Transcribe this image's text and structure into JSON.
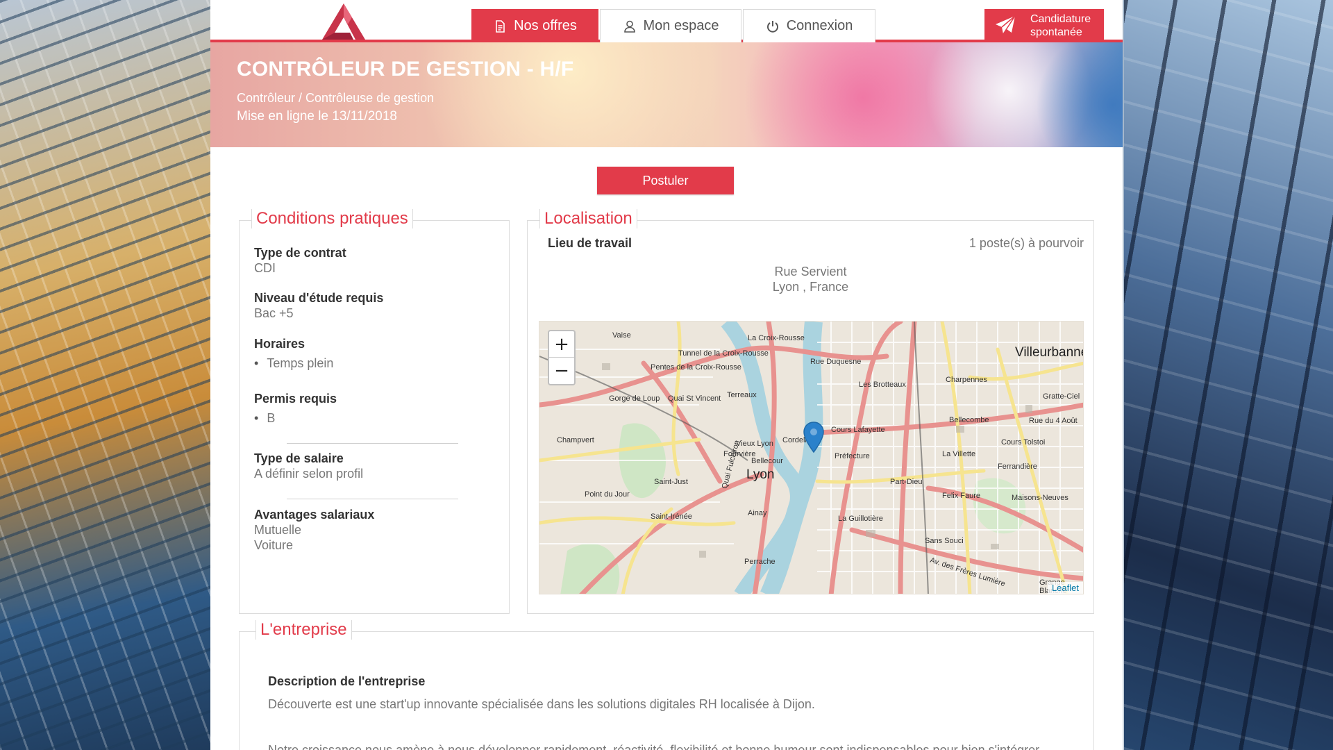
{
  "header": {
    "nav": [
      {
        "label": "Nos offres",
        "icon": "document-icon"
      },
      {
        "label": "Mon espace",
        "icon": "user-icon"
      },
      {
        "label": "Connexion",
        "icon": "power-icon"
      }
    ],
    "spontaneous_line1": "Candidature",
    "spontaneous_line2": "spontanée",
    "accent_color": "#e23b4a"
  },
  "hero": {
    "title": "CONTRÔLEUR DE GESTION - H/F",
    "subtitle": "Contrôleur / Contrôleuse de gestion",
    "posted": "Mise en ligne le 13/11/2018"
  },
  "apply_label": "Postuler",
  "conditions": {
    "legend": "Conditions pratiques",
    "contract_label": "Type de contrat",
    "contract_value": "CDI",
    "education_label": "Niveau d'étude requis",
    "education_value": "Bac +5",
    "hours_label": "Horaires",
    "hours_items": [
      "Temps plein"
    ],
    "license_label": "Permis requis",
    "license_items": [
      "B"
    ],
    "salary_label": "Type de salaire",
    "salary_value": "A définir selon profil",
    "benefits_label": "Avantages salariaux",
    "benefits_items": [
      "Mutuelle",
      "Voiture"
    ]
  },
  "location": {
    "legend": "Localisation",
    "workplace_label": "Lieu de travail",
    "positions": "1 poste(s) à pourvoir",
    "address_line1": "Rue Servient",
    "address_line2": "Lyon , France",
    "map": {
      "zoom_in": "+",
      "zoom_out": "−",
      "attribution": "Leaflet",
      "labels": [
        "Villeurbanne",
        "Lyon",
        "La Croix-Rousse",
        "Rue Duquesne",
        "Les Brotteaux",
        "Cours Lafayette",
        "Charpennes",
        "Gratte-Ciel",
        "Bellecombe",
        "Rue du 4 Août",
        "Cours Tolstoi",
        "La Villette",
        "Ferrandière",
        "Felix Faure",
        "Maisons-Neuves",
        "Part-Dieu",
        "Préfecture",
        "Vieux Lyon",
        "Fourvière",
        "Saint-Just",
        "Saint-Irénée",
        "Point du Jour",
        "Champvert",
        "Gorge de Loup",
        "Ainay",
        "Perrache",
        "La Guillotière",
        "Sans Souci",
        "Av. des Frères Lumière",
        "Grange Blanche",
        "Tunnel de la Croix-Rousse",
        "Pentes de la Croix-Rousse",
        "Quai St Vincent",
        "Terreaux",
        "Vaise",
        "Quai Fulchiron",
        "Cordeliers",
        "Bellecour"
      ]
    }
  },
  "company": {
    "legend": "L'entreprise",
    "desc_title": "Description de l'entreprise",
    "desc": "Découverte est une start'up innovante spécialisée dans les solutions digitales RH localisée à Dijon.",
    "desc2": "Notre croissance nous amène à nous développer rapidement, réactivité, flexibilité et bonne humeur sont indispensables pour bien s'intégrer"
  }
}
